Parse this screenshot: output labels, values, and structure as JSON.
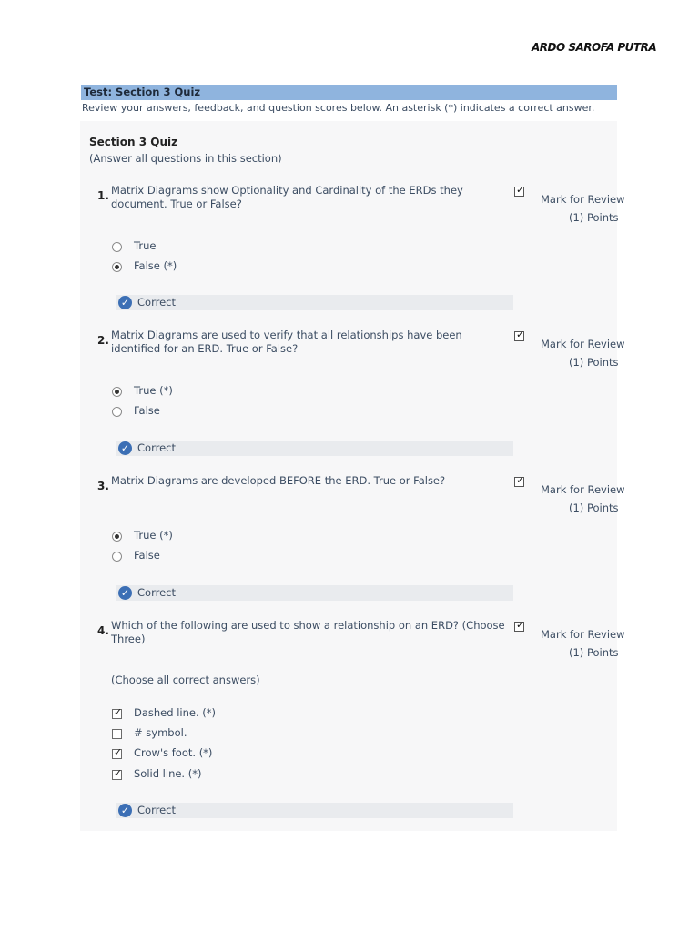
{
  "header": {
    "author": "ARDO SAROFA PUTRA",
    "title": "Test: Section 3 Quiz",
    "instructions": "Review your answers, feedback, and question scores below. An asterisk (*) indicates a correct answer."
  },
  "section": {
    "title": "Section 3 Quiz",
    "note": "(Answer all questions in this section)"
  },
  "questions": [
    {
      "number": "1.",
      "text": "Matrix Diagrams show Optionality and Cardinality of the ERDs they document. True or False?",
      "review_label": "Mark for Review",
      "points": "(1) Points",
      "review_checked": true,
      "options": [
        {
          "label": "True",
          "selected": false
        },
        {
          "label": "False (*)",
          "selected": true
        }
      ],
      "feedback": "Correct"
    },
    {
      "number": "2.",
      "text": "Matrix Diagrams are used to verify that all relationships have been identified for an ERD. True or False?",
      "review_label": "Mark for Review",
      "points": "(1) Points",
      "review_checked": true,
      "options": [
        {
          "label": "True (*)",
          "selected": true
        },
        {
          "label": "False",
          "selected": false
        }
      ],
      "feedback": "Correct"
    },
    {
      "number": "3.",
      "text": "Matrix Diagrams are developed BEFORE the ERD. True or False?",
      "review_label": "Mark for Review",
      "points": "(1) Points",
      "review_checked": true,
      "options": [
        {
          "label": "True (*)",
          "selected": true
        },
        {
          "label": "False",
          "selected": false
        }
      ],
      "feedback": "Correct"
    },
    {
      "number": "4.",
      "text": "Which of the following are used to show a relationship on an ERD? (Choose Three)",
      "review_label": "Mark for Review",
      "points": "(1) Points",
      "review_checked": true,
      "choose_note": "(Choose all correct answers)",
      "options": [
        {
          "label": "Dashed line. (*)",
          "selected": true
        },
        {
          "label": "# symbol.",
          "selected": false
        },
        {
          "label": "Crow's foot. (*)",
          "selected": true
        },
        {
          "label": "Solid line. (*)",
          "selected": true
        }
      ],
      "feedback": "Correct"
    }
  ]
}
